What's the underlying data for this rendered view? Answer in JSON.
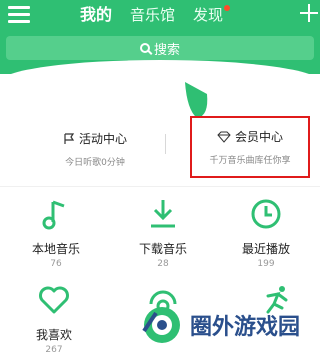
{
  "tabs": [
    {
      "label": "我的",
      "active": true
    },
    {
      "label": "音乐馆",
      "active": false
    },
    {
      "label": "发现",
      "active": false,
      "has_dot": true
    }
  ],
  "search": {
    "placeholder": "搜索"
  },
  "cards": [
    {
      "title": "活动中心",
      "subtitle": "今日听歌0分钟",
      "icon": "flag-icon"
    },
    {
      "title": "会员中心",
      "subtitle": "千万音乐曲库任你享",
      "icon": "diamond-icon"
    }
  ],
  "grid": [
    {
      "label": "本地音乐",
      "count": "76",
      "icon": "music-note-icon"
    },
    {
      "label": "下载音乐",
      "count": "28",
      "icon": "download-icon"
    },
    {
      "label": "最近播放",
      "count": "199",
      "icon": "clock-icon"
    },
    {
      "label": "我喜欢",
      "count": "267",
      "icon": "heart-icon"
    },
    {
      "label": "",
      "count": "",
      "icon": "radio-icon"
    },
    {
      "label": "",
      "count": "",
      "icon": "running-man-icon"
    }
  ],
  "watermark": {
    "text": "圈外游戏园"
  },
  "colors": {
    "brand_green": "#2fbf73",
    "highlight_red": "#e01b1b"
  }
}
